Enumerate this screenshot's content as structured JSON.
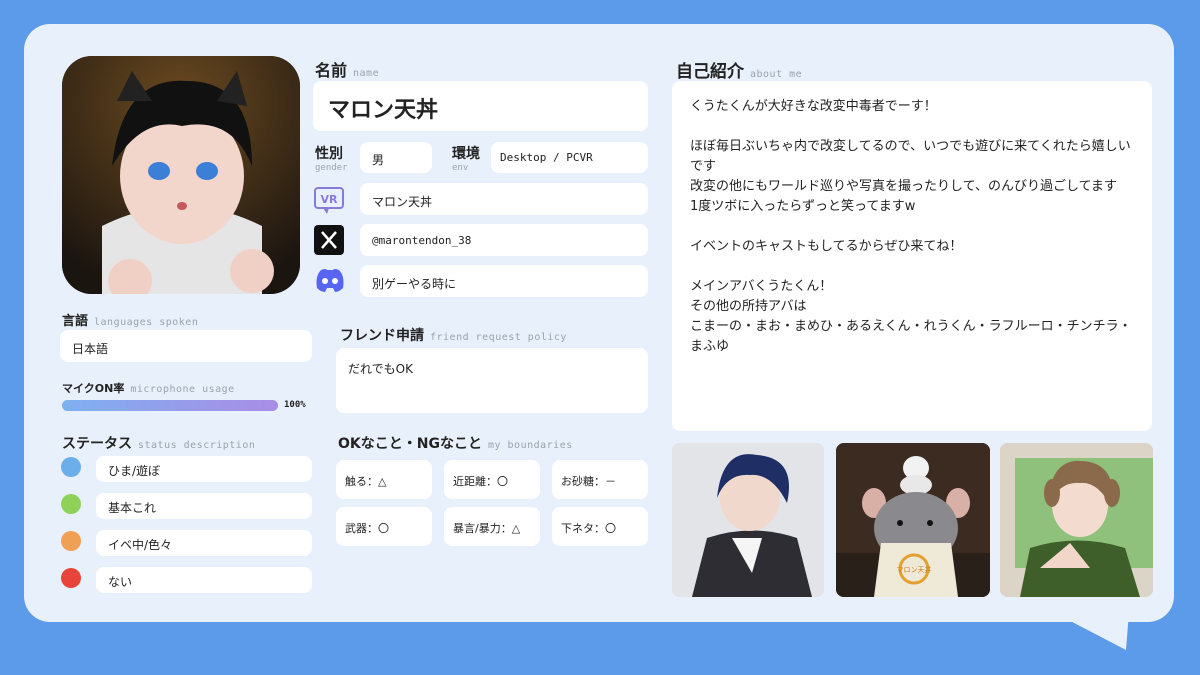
{
  "profile": {
    "name_label": "名前",
    "name_sub": "name",
    "name": "マロン天丼",
    "gender_label": "性別",
    "gender_sub": "gender",
    "gender": "男",
    "env_label": "環境",
    "env_sub": "env",
    "env": "Desktop / PCVR",
    "vrchat_name": "マロン天丼",
    "x_handle": "@marontendon_38",
    "discord_note": "別ゲーやる時に",
    "vr_icon_text": "VR"
  },
  "languages": {
    "label": "言語",
    "sub": "languages spoken",
    "value": "日本語"
  },
  "mic": {
    "label": "マイクON率",
    "sub": "microphone usage",
    "percent_text": "100%",
    "percent": 100
  },
  "status": {
    "label": "ステータス",
    "sub": "status description",
    "items": [
      {
        "color": "#6aaeea",
        "text": "ひま/遊ぼ"
      },
      {
        "color": "#8ed25a",
        "text": "基本これ"
      },
      {
        "color": "#f0a055",
        "text": "イベ中/色々"
      },
      {
        "color": "#e8443a",
        "text": "ない"
      }
    ]
  },
  "friend": {
    "label": "フレンド申請",
    "sub": "friend request policy",
    "value": "だれでもOK"
  },
  "boundaries": {
    "label": "OKなこと・NGなこと",
    "sub": "my boundaries",
    "items": [
      "触る：△",
      "近距離：〇",
      "お砂糖：－",
      "武器：〇",
      "暴言/暴力：△",
      "下ネタ：〇"
    ]
  },
  "about": {
    "label": "自己紹介",
    "sub": "about me",
    "text": "くうたくんが大好きな改変中毒者でーす！\n\nほぼ毎日ぶいちゃ内で改変してるので、いつでも遊びに来てくれたら嬉しいです\n改変の他にもワールド巡りや写真を撮ったりして、のんびり過ごしてます\n1度ツボに入ったらずっと笑ってますw\n\nイベントのキャストもしてるからぜひ来てね！\n\nメインアバくうたくん！\nその他の所持アバは\nこまーの・まお・まめひ・あるえくん・れうくん・ラフルーロ・チンチラ・まふゆ"
  },
  "photo3_label": "マロン天丼"
}
